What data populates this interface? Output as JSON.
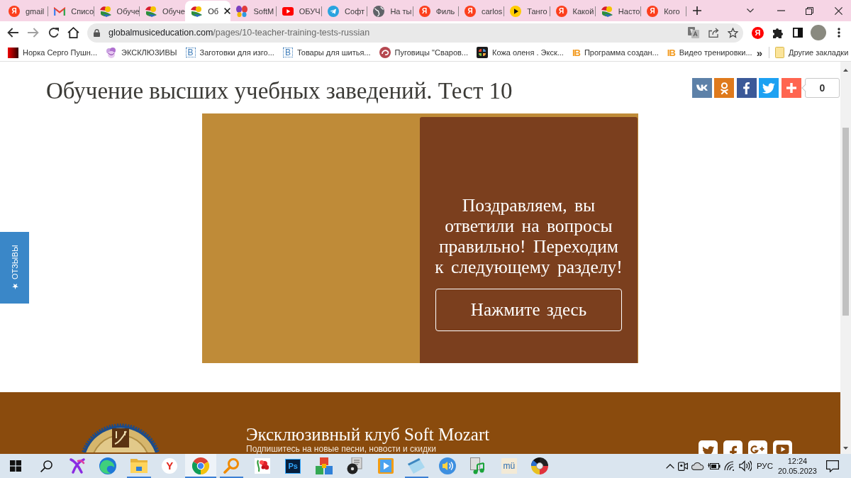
{
  "browser": {
    "tabs": [
      {
        "label": "gmail",
        "kind": "yandex",
        "glyph": "Я",
        "selected": false
      },
      {
        "label": "Списо",
        "kind": "gmail",
        "selected": false
      },
      {
        "label": "Обуче",
        "kind": "mozart",
        "selected": false
      },
      {
        "label": "Обуче",
        "kind": "mozart",
        "selected": false
      },
      {
        "label": "Об",
        "kind": "mozart",
        "selected": true
      },
      {
        "label": "SoftM",
        "kind": "butterfly",
        "selected": false
      },
      {
        "label": "ОБУЧ",
        "kind": "youtube",
        "selected": false
      },
      {
        "label": "Софт",
        "kind": "telegram",
        "selected": false
      },
      {
        "label": "На ты",
        "kind": "globe",
        "selected": false
      },
      {
        "label": "Филь",
        "kind": "yandex",
        "glyph": "Я",
        "selected": false
      },
      {
        "label": "carlos",
        "kind": "yandex",
        "glyph": "Я",
        "selected": false
      },
      {
        "label": "Танго",
        "kind": "play",
        "selected": false
      },
      {
        "label": "Какой",
        "kind": "yandex",
        "glyph": "Я",
        "selected": false
      },
      {
        "label": "Насто",
        "kind": "mozart",
        "selected": false
      },
      {
        "label": "Кого",
        "kind": "yandex",
        "glyph": "Я",
        "selected": false
      }
    ],
    "address_bar": {
      "domain": "globalmusiceducation.com",
      "path": "/pages/10-teacher-training-tests-russian"
    },
    "extension_glyph": "Я",
    "bookmarks": [
      {
        "label": "Норка Серго Пушн...",
        "kind": "gradient"
      },
      {
        "label": "ЭКСКЛЮЗИВЫ",
        "kind": "sticker"
      },
      {
        "label": "Заготовки для изго...",
        "kind": "letter",
        "glyph": "B"
      },
      {
        "label": "Товары для шитья...",
        "kind": "letter",
        "glyph": "B"
      },
      {
        "label": "Пуговицы \"Сваров...",
        "kind": "swirl"
      },
      {
        "label": "Кожа оленя . Экск...",
        "kind": "pinwheel"
      },
      {
        "label": "Программа создан...",
        "kind": "orange-letters",
        "glyph": "IB"
      },
      {
        "label": "Видео тренировки...",
        "kind": "orange-letters",
        "glyph": "IB"
      }
    ],
    "more_glyph": "»",
    "other_bookmarks": "Другие закладки"
  },
  "page": {
    "title": "Обучение высших учебных заведений. Тест 10",
    "share_buttons": [
      {
        "kind": "vk",
        "color": "#5d81a8"
      },
      {
        "kind": "ok",
        "color": "#df7a1c"
      },
      {
        "kind": "facebook",
        "color": "#3b5998"
      },
      {
        "kind": "twitter",
        "color": "#1da1f2"
      },
      {
        "kind": "more",
        "color": "#ff6550"
      }
    ],
    "share_count": "0",
    "quiz": {
      "message": "Поздравляем, вы ответили на вопросы правильно! Переходим к следующему разделу!",
      "button": "Нажмите здесь"
    },
    "feedback_tab": "★ ОТЗЫВЫ",
    "footer": {
      "heading": "Эксклюзивный клуб Soft Mozart",
      "subtitle": "Подпишитесь на новые песни, новости и скидки",
      "social": [
        {
          "kind": "twitter"
        },
        {
          "kind": "facebook"
        },
        {
          "kind": "google-plus"
        },
        {
          "kind": "youtube"
        }
      ]
    }
  },
  "taskbar": {
    "apps": [
      {
        "kind": "start",
        "running": false,
        "selected": false
      },
      {
        "kind": "search",
        "running": false,
        "selected": false
      },
      {
        "kind": "x-shape",
        "running": false,
        "selected": false
      },
      {
        "kind": "swirl",
        "running": false,
        "selected": false
      },
      {
        "kind": "folder",
        "running": true,
        "selected": false
      },
      {
        "kind": "letter",
        "glyph": "Y",
        "running": false,
        "selected": false
      },
      {
        "kind": "chrome",
        "running": true,
        "selected": true
      },
      {
        "kind": "magnifier",
        "running": true,
        "selected": false
      },
      {
        "kind": "flower",
        "running": false,
        "selected": false
      },
      {
        "kind": "tile-letters",
        "glyph": "Ps",
        "running": false,
        "selected": false
      },
      {
        "kind": "cubes",
        "running": false,
        "selected": false
      },
      {
        "kind": "disc",
        "running": false,
        "selected": false
      },
      {
        "kind": "media",
        "running": false,
        "selected": false
      },
      {
        "kind": "notepad",
        "running": true,
        "selected": false
      },
      {
        "kind": "speaker",
        "running": false,
        "selected": false
      },
      {
        "kind": "music-file",
        "running": false,
        "selected": false
      },
      {
        "kind": "cream-letters",
        "glyph": "mü",
        "running": false,
        "selected": false
      },
      {
        "kind": "color-wheel",
        "running": false,
        "selected": false
      }
    ],
    "language": "РУС",
    "time": "12:24",
    "date": "20.05.2023"
  }
}
